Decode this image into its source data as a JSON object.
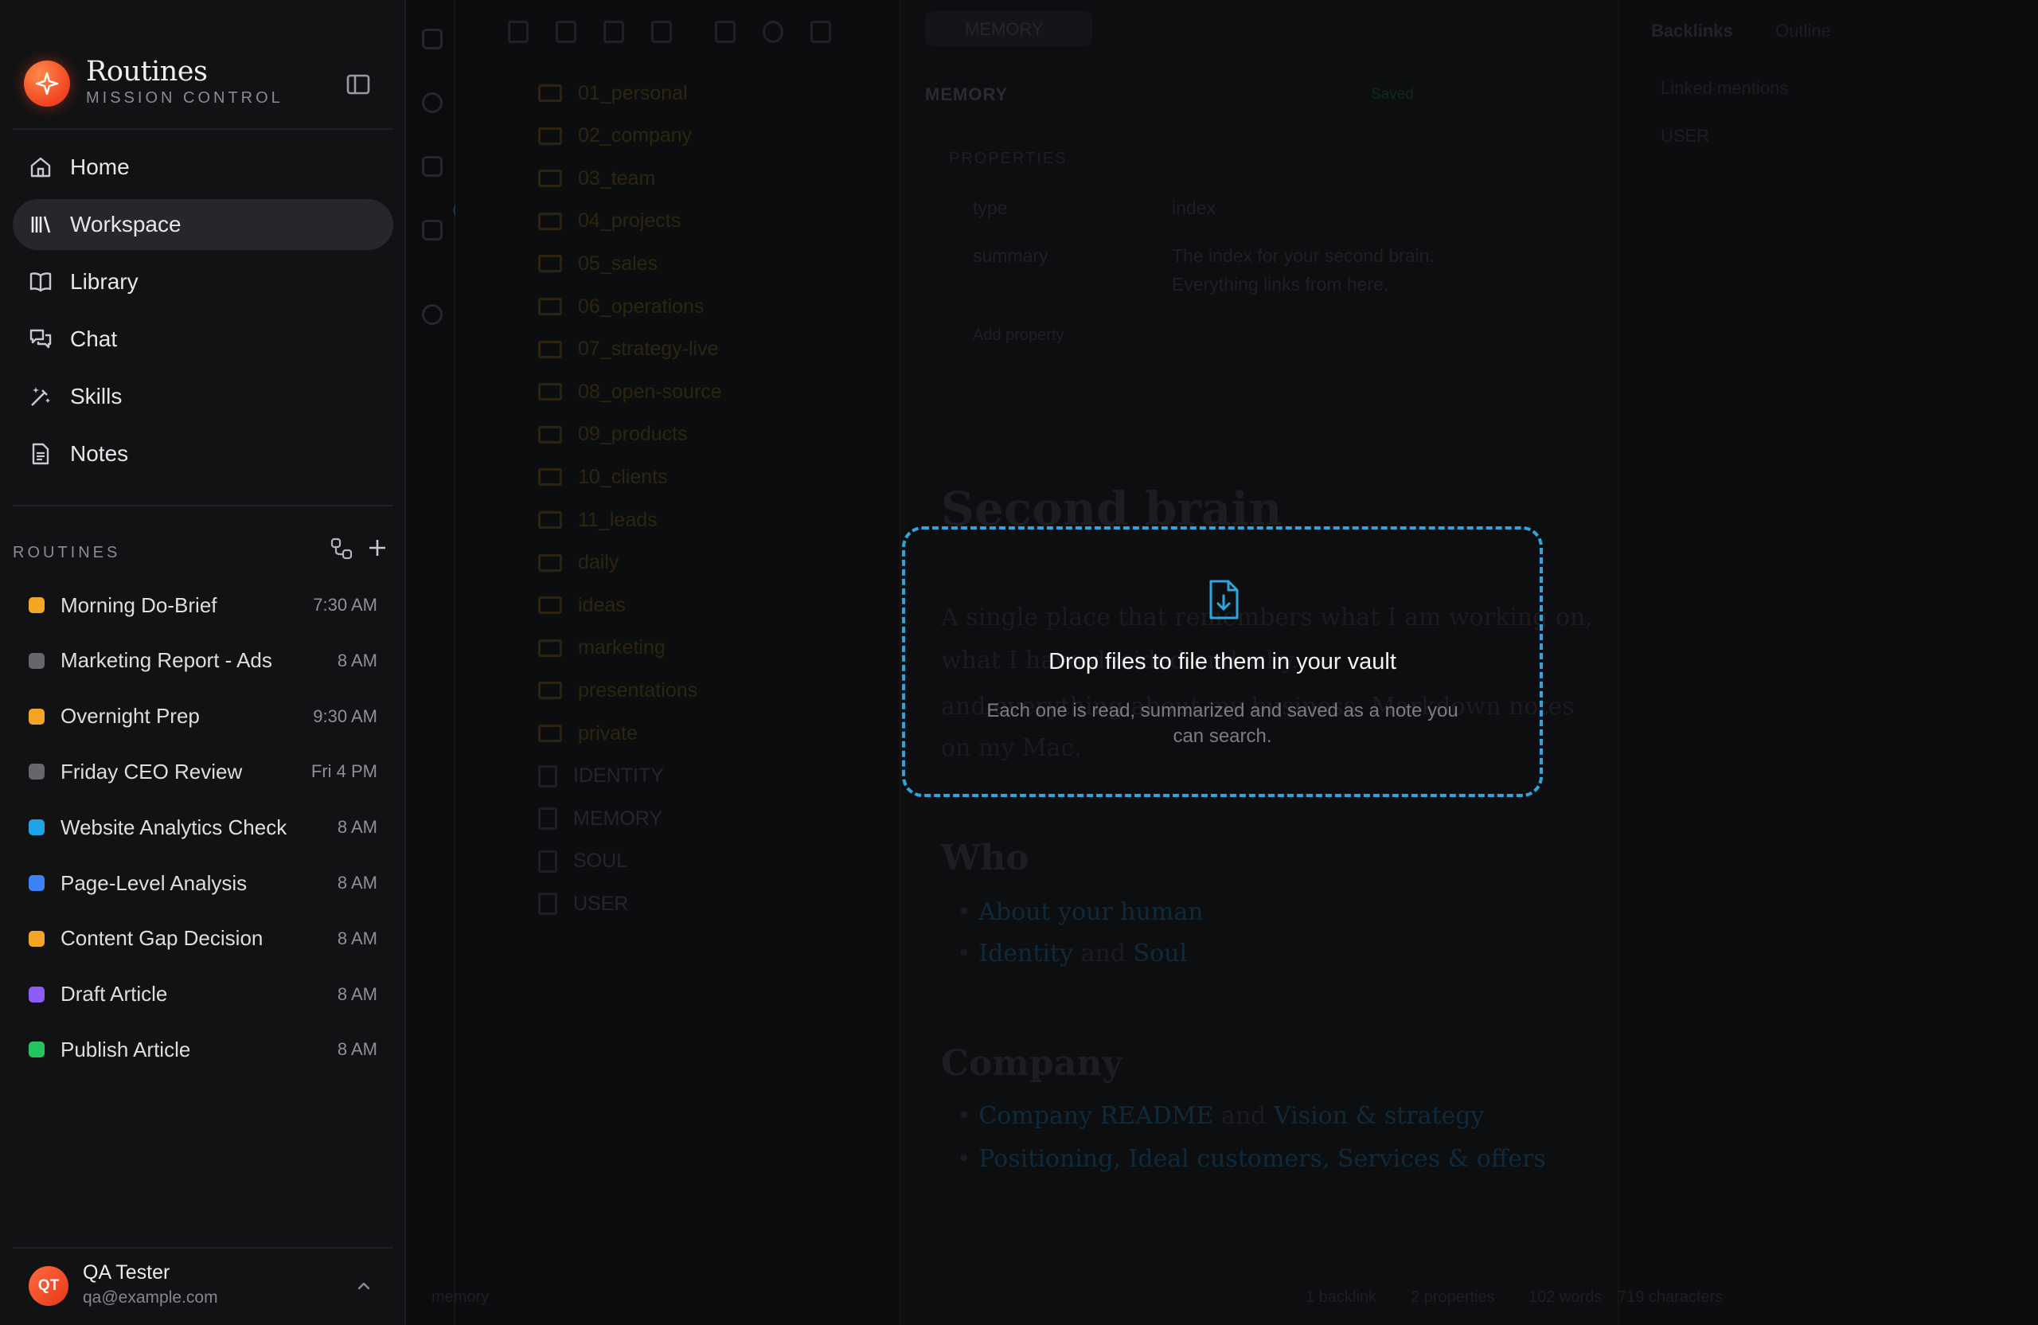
{
  "brand": {
    "title": "Routines",
    "subtitle": "MISSION CONTROL"
  },
  "nav": [
    {
      "label": "Home",
      "icon": "home-icon",
      "active": false
    },
    {
      "label": "Workspace",
      "icon": "library-icon",
      "active": true
    },
    {
      "label": "Library",
      "icon": "book-icon",
      "active": false
    },
    {
      "label": "Chat",
      "icon": "chat-icon",
      "active": false
    },
    {
      "label": "Skills",
      "icon": "wand-icon",
      "active": false
    },
    {
      "label": "Notes",
      "icon": "document-icon",
      "active": false
    }
  ],
  "routines": {
    "header": "ROUTINES",
    "items": [
      {
        "name": "Morning Do-Brief",
        "time": "7:30 AM",
        "color": "#f5a524"
      },
      {
        "name": "Marketing Report - Ads",
        "time": "8 AM",
        "color": "#66676b"
      },
      {
        "name": "Overnight Prep",
        "time": "9:30 AM",
        "color": "#f5a524"
      },
      {
        "name": "Friday CEO Review",
        "time": "Fri 4 PM",
        "color": "#66676b"
      },
      {
        "name": "Website Analytics Check",
        "time": "8 AM",
        "color": "#1fa3e6"
      },
      {
        "name": "Page-Level Analysis",
        "time": "8 AM",
        "color": "#3b82f6"
      },
      {
        "name": "Content Gap Decision",
        "time": "8 AM",
        "color": "#f5a524"
      },
      {
        "name": "Draft Article",
        "time": "8 AM",
        "color": "#8b5cf6"
      },
      {
        "name": "Publish Article",
        "time": "8 AM",
        "color": "#22c55e"
      }
    ]
  },
  "user": {
    "initials": "QT",
    "name": "QA Tester",
    "email": "qa@example.com"
  },
  "background": {
    "tree": [
      {
        "label": "01_personal",
        "type": "folder"
      },
      {
        "label": "02_company",
        "type": "folder"
      },
      {
        "label": "03_team",
        "type": "folder"
      },
      {
        "label": "04_projects",
        "type": "folder"
      },
      {
        "label": "05_sales",
        "type": "folder"
      },
      {
        "label": "06_operations",
        "type": "folder"
      },
      {
        "label": "07_strategy-live",
        "type": "folder"
      },
      {
        "label": "08_open-source",
        "type": "folder"
      },
      {
        "label": "09_products",
        "type": "folder"
      },
      {
        "label": "10_clients",
        "type": "folder"
      },
      {
        "label": "11_leads",
        "type": "folder"
      },
      {
        "label": "daily",
        "type": "folder"
      },
      {
        "label": "ideas",
        "type": "folder"
      },
      {
        "label": "marketing",
        "type": "folder"
      },
      {
        "label": "presentations",
        "type": "folder"
      },
      {
        "label": "private",
        "type": "folder"
      },
      {
        "label": "IDENTITY",
        "type": "file"
      },
      {
        "label": "MEMORY",
        "type": "file"
      },
      {
        "label": "SOUL",
        "type": "file"
      },
      {
        "label": "USER",
        "type": "file"
      }
    ],
    "doc_tab": "MEMORY",
    "doc_label": "MEMORY",
    "saved": "Saved",
    "properties_header": "PROPERTIES",
    "prop_type_key": "type",
    "prop_type_value": "index",
    "prop_summary_key": "summary",
    "prop_summary_value_1": "The index for your second brain.",
    "prop_summary_value_2": "Everything links from here.",
    "add_property": "Add property",
    "heading": "Second brain",
    "para_1": "A single place that remembers what I am working on,",
    "para_2": "what I have decided and why.",
    "para_3": "and everything about my business. Markdown notes",
    "para_4": "on my Mac.",
    "who_heading": "Who",
    "who_link_1": "About your human",
    "who_link_2": "Identity",
    "who_and": "and",
    "who_link_3": "Soul",
    "company_heading": "Company",
    "company_link_1": "Company README",
    "company_and": "and",
    "company_link_2": "Vision & strategy",
    "company_links_2": "Positioning, Ideal customers, Services & offers",
    "backlinks_tab": "Backlinks",
    "outline_tab": "Outline",
    "linked_mentions": "Linked mentions",
    "backlink_user": "USER",
    "status_left": "memory",
    "status_backlink": "1 backlink",
    "status_props": "2 properties",
    "status_words": "102 words",
    "status_chars": "719 characters"
  },
  "dropzone": {
    "title": "Drop files to file them in your vault",
    "description": "Each one is read, summarized and saved as a note you can search.",
    "icon": "file-download-icon",
    "border_color": "#2fa6db"
  }
}
